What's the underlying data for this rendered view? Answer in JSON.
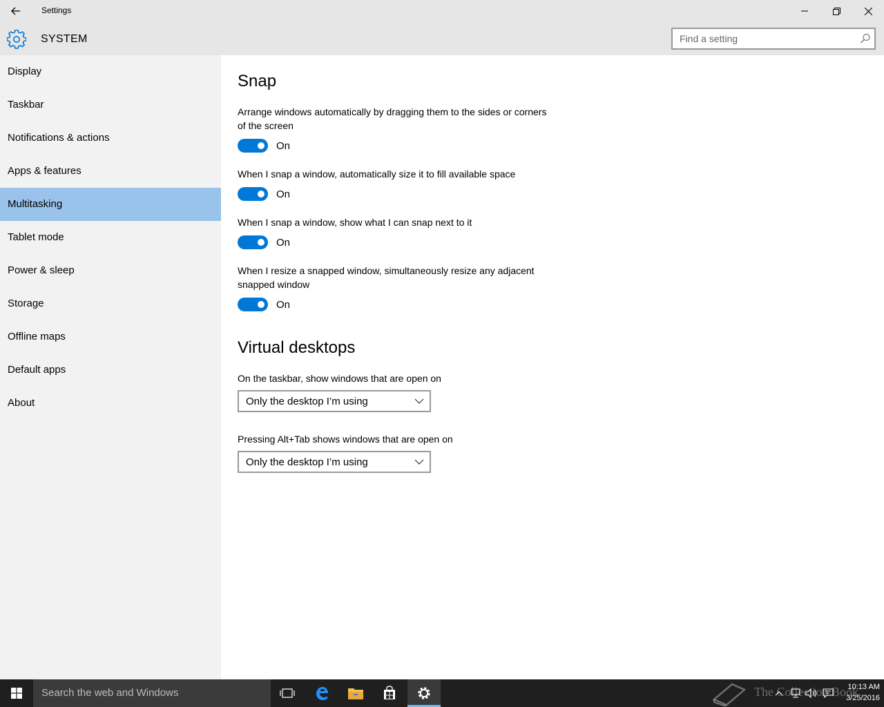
{
  "window": {
    "title": "Settings"
  },
  "header": {
    "section_title": "SYSTEM",
    "search_placeholder": "Find a setting"
  },
  "sidebar": {
    "items": [
      {
        "label": "Display"
      },
      {
        "label": "Taskbar"
      },
      {
        "label": "Notifications & actions"
      },
      {
        "label": "Apps & features"
      },
      {
        "label": "Multitasking",
        "selected": true
      },
      {
        "label": "Tablet mode"
      },
      {
        "label": "Power & sleep"
      },
      {
        "label": "Storage"
      },
      {
        "label": "Offline maps"
      },
      {
        "label": "Default apps"
      },
      {
        "label": "About"
      }
    ]
  },
  "snap": {
    "heading": "Snap",
    "settings": [
      {
        "description": "Arrange windows automatically by dragging them to the sides or corners of the screen",
        "state": "On"
      },
      {
        "description": "When I snap a window, automatically size it to fill available space",
        "state": "On"
      },
      {
        "description": "When I snap a window, show what I can snap next to it",
        "state": "On"
      },
      {
        "description": "When I resize a snapped window, simultaneously resize any adjacent snapped window",
        "state": "On"
      }
    ]
  },
  "virtual_desktops": {
    "heading": "Virtual desktops",
    "taskbar_label": "On the taskbar, show windows that are open on",
    "taskbar_value": "Only the desktop I’m using",
    "alttab_label": "Pressing Alt+Tab shows windows that are open on",
    "alttab_value": "Only the desktop I’m using"
  },
  "taskbar": {
    "search_placeholder": "Search the web and Windows",
    "watermark": "The Collection Book",
    "time": "10:13 AM",
    "date": "3/25/2016"
  },
  "colors": {
    "accent": "#0078d7",
    "selected_nav": "#99c3ea",
    "sidebar_bg": "#f2f2f2",
    "titlebar_bg": "#e6e6e6",
    "taskbar_bg": "#1f1f1f"
  }
}
